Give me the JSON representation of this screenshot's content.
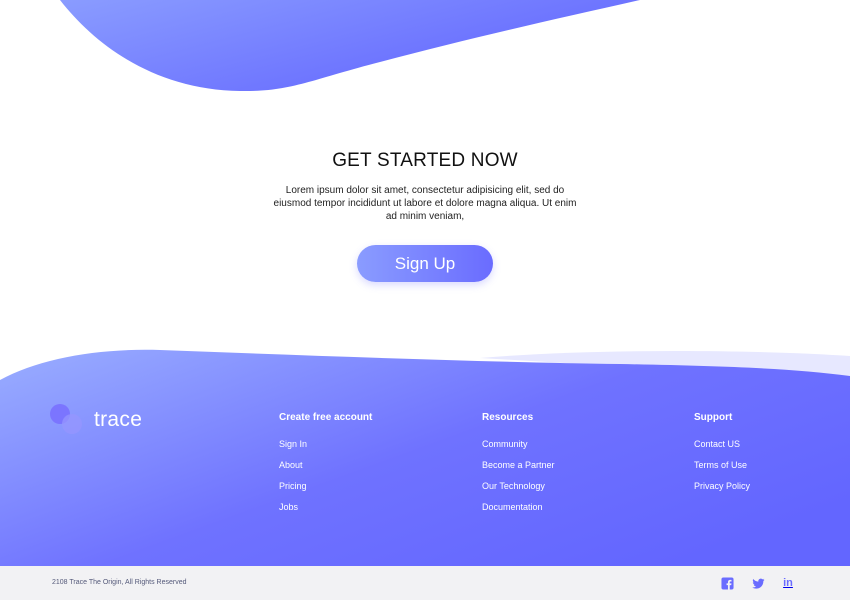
{
  "cta": {
    "title": "GET STARTED NOW",
    "text": "Lorem ipsum dolor sit amet, consectetur adipisicing elit, sed do eiusmod tempor incididunt ut labore et dolore magna aliqua. Ut enim ad minim veniam,",
    "button_label": "Sign Up"
  },
  "footer": {
    "brand": "trace",
    "columns": [
      {
        "title": "Create free account",
        "links": [
          "Sign In",
          "About",
          "Pricing",
          "Jobs"
        ]
      },
      {
        "title": "Resources",
        "links": [
          "Community",
          "Become a Partner",
          "Our Technology",
          "Documentation"
        ]
      },
      {
        "title": "Support",
        "links": [
          "Contact US",
          "Terms of Use",
          "Privacy Policy"
        ]
      }
    ],
    "copyright": "2108 Trace The Origin, All Rights Reserved",
    "social": [
      "facebook-icon",
      "twitter-icon",
      "linkedin-icon"
    ],
    "linkedin_label": "in"
  },
  "colors": {
    "accent_light": "#8a9cff",
    "accent": "#6a6cff",
    "bottom_bar": "#f2f2f4"
  }
}
